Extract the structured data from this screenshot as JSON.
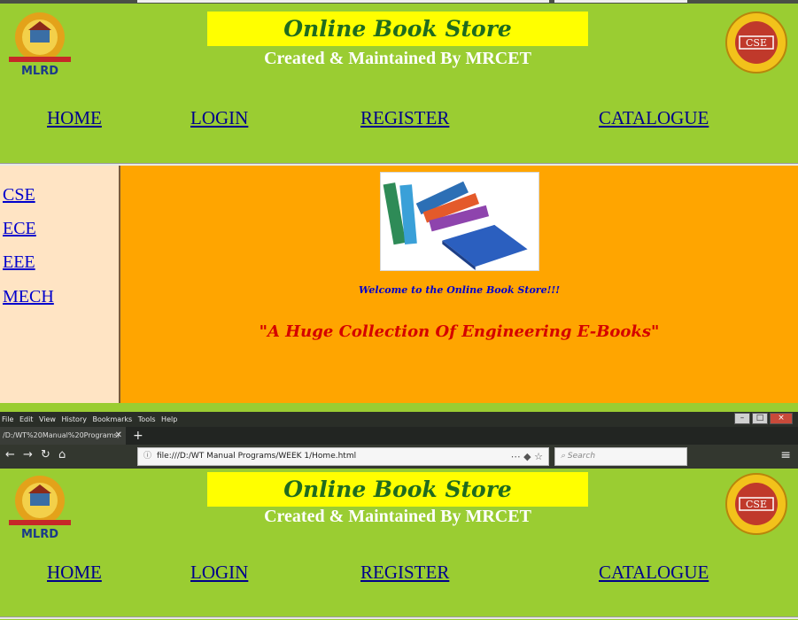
{
  "header": {
    "title": "Online Book Store",
    "subtitle": "Created & Maintained By MRCET",
    "logo_left_text": "MLRD",
    "logo_right_text": "CSE"
  },
  "nav": [
    "HOME",
    "LOGIN",
    "REGISTER",
    "CATALOGUE"
  ],
  "sidebar": [
    "CSE",
    "ECE",
    "EEE",
    "MECH"
  ],
  "main": {
    "welcome": "Welcome to the Online Book Store!!!",
    "tagline": "\"A Huge Collection Of Engineering E-Books\""
  },
  "browser": {
    "menu": [
      "File",
      "Edit",
      "View",
      "History",
      "Bookmarks",
      "Tools",
      "Help"
    ],
    "tab_title": "/D:/WT%20Manual%20Programs/",
    "url": "file:///D:/WT Manual Programs/WEEK 1/Home.html",
    "search_placeholder": "Search"
  },
  "colors": {
    "page_bg": "#9acd32",
    "title_bg": "#ffff00",
    "sidebar_bg": "#ffe4c4",
    "main_bg": "#ffa500",
    "link": "#00008b"
  }
}
